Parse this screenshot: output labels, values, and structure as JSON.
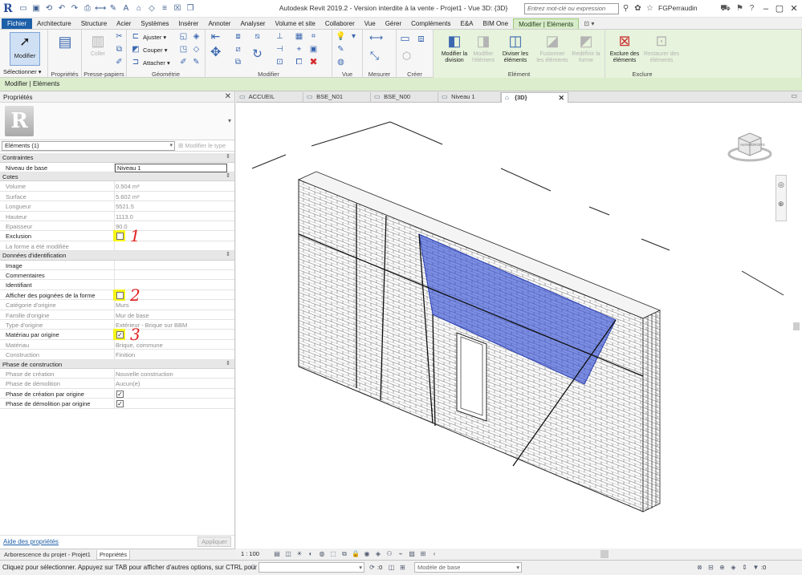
{
  "titlebar": {
    "app_logo": "R",
    "title": "Autodesk Revit 2019.2 - Version interdite à la vente - Projet1 - Vue 3D: {3D}",
    "search_placeholder": "Entrez mot-clé ou expression",
    "user": "FGPerraudin",
    "icons": [
      "open-icon",
      "save-icon",
      "sync-icon",
      "undo-icon",
      "redo-icon",
      "print-icon",
      "measure-icon",
      "tag-icon",
      "text-icon",
      "3d-view-icon",
      "section-icon",
      "thin-lines-icon",
      "close-hidden-icon",
      "switch-windows-icon"
    ]
  },
  "ribbon_tabs": [
    "Fichier",
    "Architecture",
    "Structure",
    "Acier",
    "Systèmes",
    "Insérer",
    "Annoter",
    "Analyser",
    "Volume et site",
    "Collaborer",
    "Vue",
    "Gérer",
    "Compléments",
    "E&A",
    "BIM One",
    "Modifier | Eléments"
  ],
  "ribbon": {
    "select": {
      "modifier": "Modifier",
      "dropdown": "Sélectionner ▾"
    },
    "properties": {
      "label": "Propriétés"
    },
    "clipboard": {
      "label": "Presse-papiers",
      "paste": "Coller"
    },
    "geometry": {
      "label": "Géométrie",
      "cut": "Couper",
      "join": "Ajuster",
      "attach": "Attacher",
      "cope": "Couper"
    },
    "modify": {
      "label": "Modifier"
    },
    "view": {
      "label": "Vue"
    },
    "measure": {
      "label": "Mesurer"
    },
    "create": {
      "label": "Créer"
    },
    "element": {
      "label": "Elément",
      "split_face": "Modifier la division",
      "edit_element": "Modifier l'élément",
      "divide": "Diviser les éléments",
      "merge": "Fusionner les éléments",
      "reset_shape": "Redéfinir la forme"
    },
    "exclude": {
      "label": "Exclure",
      "exclude": "Exclure des éléments",
      "restore": "Restaurer des éléments"
    }
  },
  "options_bar": {
    "label": "Modifier | Eléments"
  },
  "properties": {
    "title": "Propriétés",
    "type_logo": "R",
    "element_selector": "Eléments (1)",
    "edit_type": "Modifier le type",
    "groups": [
      {
        "name": "Contraintes",
        "rows": [
          {
            "name": "Niveau de base",
            "value": "Niveau 1",
            "kind": "input"
          }
        ]
      },
      {
        "name": "Cotes",
        "rows": [
          {
            "name": "Volume",
            "value": "0.504 m³",
            "kind": "ro"
          },
          {
            "name": "Surface",
            "value": "5.602 m²",
            "kind": "ro"
          },
          {
            "name": "Longueur",
            "value": "5521.5",
            "kind": "ro"
          },
          {
            "name": "Hauteur",
            "value": "1113.0",
            "kind": "ro"
          },
          {
            "name": "Epaisseur",
            "value": "90.0",
            "kind": "ro"
          },
          {
            "name": "Exclusion",
            "value": "",
            "kind": "checkbox",
            "checked": false,
            "highlight": true,
            "anno": "1"
          },
          {
            "name": "La forme a été modifiée",
            "value": "",
            "kind": "ro"
          }
        ]
      },
      {
        "name": "Données d'identification",
        "rows": [
          {
            "name": "Image",
            "value": "",
            "kind": "text"
          },
          {
            "name": "Commentaires",
            "value": "",
            "kind": "text"
          },
          {
            "name": "Identifiant",
            "value": "",
            "kind": "text"
          },
          {
            "name": "Afficher des poignées de la forme",
            "value": "",
            "kind": "checkbox",
            "checked": false,
            "highlight": true,
            "anno": "2"
          },
          {
            "name": "Catégorie d'origine",
            "value": "Murs",
            "kind": "ro"
          },
          {
            "name": "Famille d'origine",
            "value": "Mur de base",
            "kind": "ro"
          },
          {
            "name": "Type d'origine",
            "value": "Extérieur - Brique sur BBM",
            "kind": "ro"
          },
          {
            "name": "Matériau par origine",
            "value": "",
            "kind": "checkbox",
            "checked": true,
            "highlight": true,
            "anno": "3"
          },
          {
            "name": "Matériau",
            "value": "Brique, commune",
            "kind": "ro"
          },
          {
            "name": "Construction",
            "value": "Finition",
            "kind": "ro"
          }
        ]
      },
      {
        "name": "Phase de construction",
        "rows": [
          {
            "name": "Phase de création",
            "value": "Nouvelle construction",
            "kind": "ro"
          },
          {
            "name": "Phase de démolition",
            "value": "Aucun(e)",
            "kind": "ro"
          },
          {
            "name": "Phase de création par origine",
            "value": "",
            "kind": "checkbox",
            "checked": true
          },
          {
            "name": "Phase de démolition par origine",
            "value": "",
            "kind": "checkbox",
            "checked": true
          }
        ]
      }
    ],
    "help_link": "Aide des propriétés",
    "apply": "Appliquer",
    "bottom_tabs": [
      "Arborescence du projet - Projet1",
      "Propriétés"
    ]
  },
  "view_tabs": [
    {
      "label": "ACCUEIL",
      "icon": "home-icon"
    },
    {
      "label": "BSE_N01",
      "icon": "plan-icon"
    },
    {
      "label": "BSE_N00",
      "icon": "plan-icon"
    },
    {
      "label": "Niveau 1",
      "icon": "plan-icon"
    },
    {
      "label": "{3D}",
      "icon": "3d-icon",
      "active": true
    }
  ],
  "viewcube": {
    "front": "AVANT",
    "right": "DROITE"
  },
  "view": {
    "scale": "1 : 100"
  },
  "status": {
    "text": "Cliquez pour sélectionner. Appuyez sur TAB pour afficher d'autres options, sur CTRL pour",
    "zero": ":0",
    "model": "Modèle de base",
    "filter": ":0"
  },
  "colors": {
    "accent": "#1d5fa8",
    "contextual": "#d9eccb",
    "selected_face": "#7b8ee3",
    "highlight": "#f5f51a",
    "annotation": "#e02020"
  }
}
